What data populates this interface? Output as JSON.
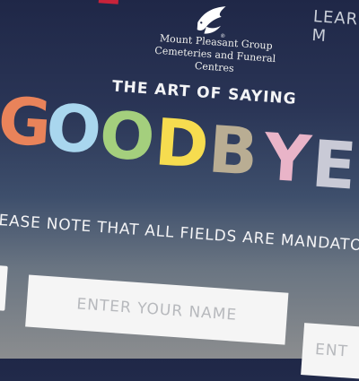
{
  "nav": {
    "learn_label": "LEARN M"
  },
  "brand": {
    "line1": "Mount Pleasant Group",
    "line2": "Cemeteries and Funeral Centres",
    "registered_mark": "®"
  },
  "hero": {
    "tagline": "THE ART OF SAYING",
    "headline_letters": [
      {
        "char": "G",
        "color": "#e9835a"
      },
      {
        "char": "O",
        "color": "#a9d6ee"
      },
      {
        "char": "O",
        "color": "#a4cf7d"
      },
      {
        "char": "D",
        "color": "#f6dc4f"
      },
      {
        "char": "B",
        "color": "#b9ad93"
      },
      {
        "char": "Y",
        "color": "#e9b4c8"
      },
      {
        "char": "E",
        "color": "#c9cad6"
      }
    ]
  },
  "form": {
    "notice": "LEASE NOTE THAT ALL FIELDS ARE MANDATORY",
    "name_placeholder": "ENTER YOUR NAME",
    "next_placeholder": "ENT"
  },
  "colors": {
    "brand_red": "#c8233a"
  }
}
